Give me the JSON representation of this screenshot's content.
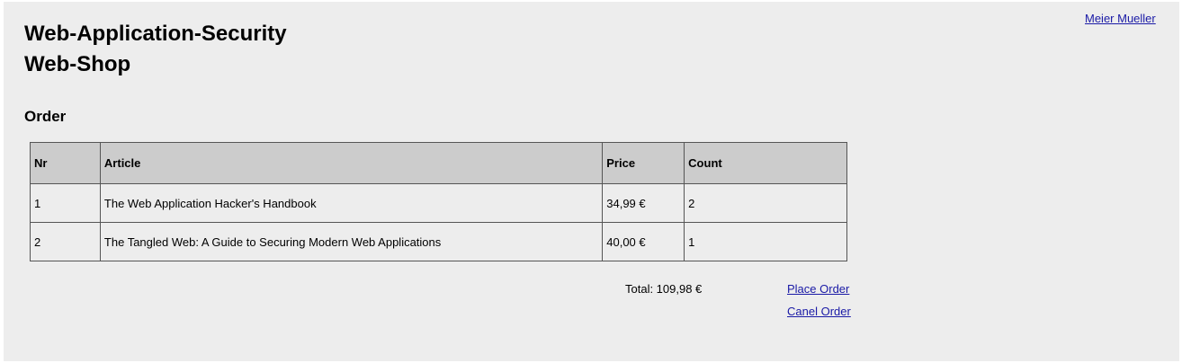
{
  "header": {
    "user_name": "Meier Mueller",
    "title_line1": "Web-Application-Security",
    "title_line2": "Web-Shop"
  },
  "order": {
    "heading": "Order",
    "columns": [
      "Nr",
      "Article",
      "Price",
      "Count"
    ],
    "rows": [
      {
        "nr": "1",
        "article": "The Web Application Hacker's Handbook",
        "price": "34,99 €",
        "count": "2"
      },
      {
        "nr": "2",
        "article": "The Tangled Web: A Guide to Securing Modern Web Applications",
        "price": "40,00 €",
        "count": "1"
      }
    ],
    "total": "Total: 109,98 €",
    "place_order_label": "Place Order",
    "cancel_order_label": "Canel Order"
  },
  "colors": {
    "background": "#ededed",
    "header_row": "#cccccc",
    "link": "#1a1aa6"
  }
}
